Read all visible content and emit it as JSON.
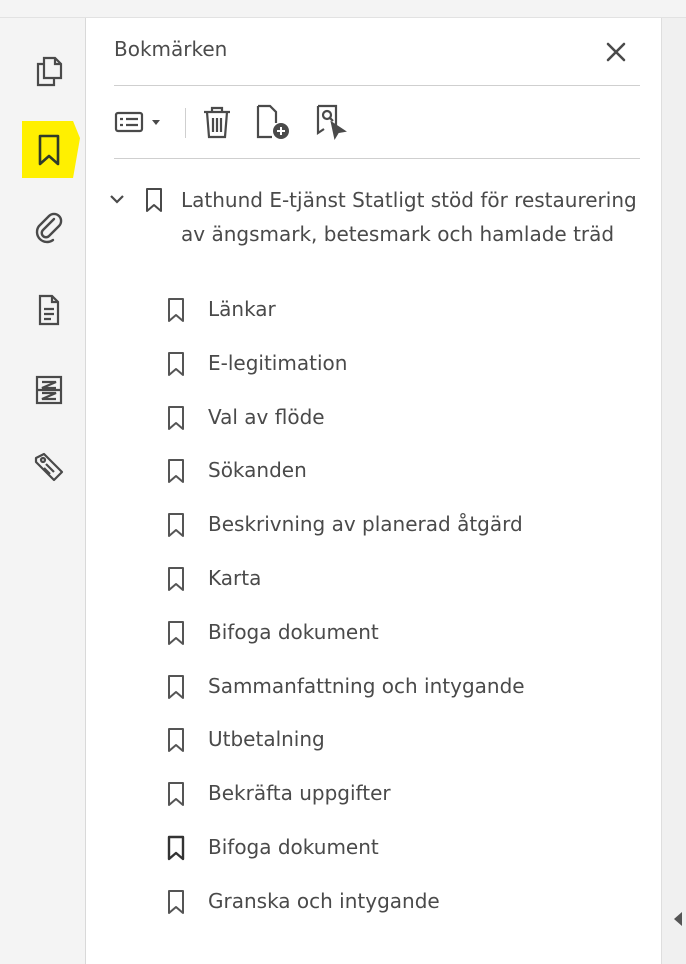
{
  "panel": {
    "title": "Bokmärken",
    "close_label": "✕"
  },
  "rail": {
    "icons": [
      "page-thumbnails-icon",
      "bookmark-icon",
      "attachment-icon",
      "document-icon",
      "compare-icon",
      "tag-icon"
    ],
    "active": "bookmark-icon",
    "active_color": "#fff000"
  },
  "toolbar": {
    "icons": [
      "options-list-icon",
      "dropdown-caret-icon",
      "delete-trash-icon",
      "new-bookmark-icon",
      "find-bookmark-icon"
    ]
  },
  "bookmarks": {
    "parent": "Lathund E-tjänst Statligt stöd för restaurering av ängsmark, betesmark och hamlade träd",
    "children": [
      "Länkar",
      "E-legitimation",
      "Val av flöde",
      "Sökanden",
      "Beskrivning av planerad åtgärd",
      "Karta",
      "Bifoga dokument",
      "Sammanfattning och intygande",
      "Utbetalning",
      "Bekräfta uppgifter",
      "Bifoga dokument",
      "Granska och intygande"
    ]
  }
}
